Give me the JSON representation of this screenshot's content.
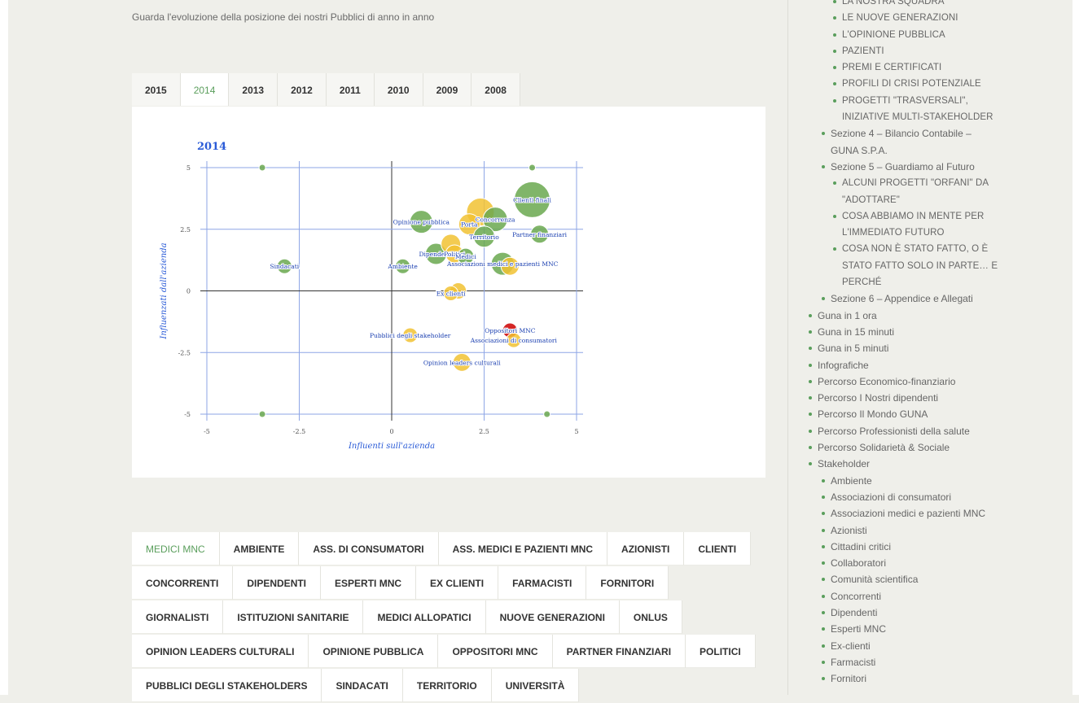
{
  "intro_text": "Guarda l'evoluzione della posizione dei nostri Pubblici di anno in anno",
  "year_tabs": [
    "2015",
    "2014",
    "2013",
    "2012",
    "2011",
    "2010",
    "2009",
    "2008"
  ],
  "active_year": "2014",
  "categories": [
    [
      "MEDICI MNC",
      "AMBIENTE",
      "ASS. DI CONSUMATORI",
      "ASS. MEDICI E PAZIENTI MNC",
      "AZIONISTI",
      "CLIENTI"
    ],
    [
      "CONCORRENTI",
      "DIPENDENTI",
      "ESPERTI MNC",
      "EX CLIENTI",
      "FARMACISTI",
      "FORNITORI"
    ],
    [
      "GIORNALISTI",
      "ISTITUZIONI SANITARIE",
      "MEDICI ALLOPATICI",
      "NUOVE GENERAZIONI",
      "ONLUS"
    ],
    [
      "OPINION LEADERS CULTURALI",
      "OPINIONE PUBBLICA",
      "OPPOSITORI MNC",
      "PARTNER FINANZIARI",
      "POLITICI"
    ],
    [
      "PUBBLICI DEGLI STAKEHOLDERS",
      "SINDACATI",
      "TERRITORIO",
      "UNIVERSITÀ"
    ]
  ],
  "active_category": "MEDICI MNC",
  "sidebar": [
    {
      "label": "LA NOSTRA SQUADRA",
      "level": 3
    },
    {
      "label": "LE NUOVE GENERAZIONI",
      "level": 3
    },
    {
      "label": "L'OPINIONE PUBBLICA",
      "level": 3
    },
    {
      "label": "PAZIENTI",
      "level": 3
    },
    {
      "label": "PREMI E CERTIFICATI",
      "level": 3
    },
    {
      "label": "PROFILI DI CRISI POTENZIALE",
      "level": 3
    },
    {
      "label": "PROGETTI \"TRASVERSALI\", INIZIATIVE MULTI-STAKEHOLDER",
      "level": 3
    },
    {
      "label": "Sezione 4 – Bilancio Contabile – GUNA S.P.A.",
      "level": 2
    },
    {
      "label": "Sezione 5 – Guardiamo al Futuro",
      "level": 2
    },
    {
      "label": "ALCUNI PROGETTI \"ORFANI\" DA \"ADOTTARE\"",
      "level": 3
    },
    {
      "label": "COSA ABBIAMO IN MENTE PER L'IMMEDIATO FUTURO",
      "level": 3
    },
    {
      "label": "COSA NON È STATO FATTO, O È STATO FATTO SOLO IN PARTE… E PERCHÉ",
      "level": 3
    },
    {
      "label": "Sezione 6 – Appendice e Allegati",
      "level": 2
    },
    {
      "label": "Guna in 1 ora",
      "level": 1
    },
    {
      "label": "Guna in 15 minuti",
      "level": 1
    },
    {
      "label": "Guna in 5 minuti",
      "level": 1
    },
    {
      "label": "Infografiche",
      "level": 1
    },
    {
      "label": "Percorso Economico-finanziario",
      "level": 1
    },
    {
      "label": "Percorso I Nostri dipendenti",
      "level": 1
    },
    {
      "label": "Percorso Il Mondo GUNA",
      "level": 1
    },
    {
      "label": "Percorso Professionisti della salute",
      "level": 1
    },
    {
      "label": "Percorso Solidarietà & Sociale",
      "level": 1
    },
    {
      "label": "Stakeholder",
      "level": 1
    },
    {
      "label": "Ambiente",
      "level": 2
    },
    {
      "label": "Associazioni di consumatori",
      "level": 2
    },
    {
      "label": "Associazioni medici e pazienti MNC",
      "level": 2
    },
    {
      "label": "Azionisti",
      "level": 2
    },
    {
      "label": "Cittadini critici",
      "level": 2
    },
    {
      "label": "Collaboratori",
      "level": 2
    },
    {
      "label": "Comunità scientifica",
      "level": 2
    },
    {
      "label": "Concorrenti",
      "level": 2
    },
    {
      "label": "Dipendenti",
      "level": 2
    },
    {
      "label": "Esperti MNC",
      "level": 2
    },
    {
      "label": "Ex-clienti",
      "level": 2
    },
    {
      "label": "Farmacisti",
      "level": 2
    },
    {
      "label": "Fornitori",
      "level": 2
    }
  ],
  "colors": {
    "accent": "#5a9e5c",
    "bubble_green": "#6aa84f",
    "bubble_yellow": "#f1c232",
    "bubble_red": "#cc0000",
    "axis_blue": "#2a5bd7"
  },
  "chart_data": {
    "type": "scatter",
    "title": "2014",
    "xlabel": "Influenti sull'azienda",
    "ylabel": "Influenzati dall'azienda",
    "xlim": [
      -5,
      5
    ],
    "ylim": [
      -5,
      5
    ],
    "xticks": [
      "-5",
      "-2.5",
      "0",
      "2.5",
      "5"
    ],
    "yticks": [
      "5",
      "2.5",
      "0",
      "-2.5",
      "-5"
    ],
    "grid": true,
    "points": [
      {
        "label": "Clienti finali",
        "x": 3.8,
        "y": 3.7,
        "r": 2.2,
        "color": "green"
      },
      {
        "label": "",
        "x": 2.4,
        "y": 3.2,
        "r": 1.7,
        "color": "yellow"
      },
      {
        "label": "Concorrenza",
        "x": 2.8,
        "y": 2.9,
        "r": 1.5,
        "color": "green"
      },
      {
        "label": "Partner finanziari",
        "x": 4.0,
        "y": 2.3,
        "r": 1.1,
        "color": "green"
      },
      {
        "label": "Opinione pubblica",
        "x": 0.8,
        "y": 2.8,
        "r": 1.4,
        "color": "green"
      },
      {
        "label": "Porta",
        "x": 2.1,
        "y": 2.7,
        "r": 1.3,
        "color": "yellow"
      },
      {
        "label": "Territorio",
        "x": 2.5,
        "y": 2.2,
        "r": 1.3,
        "color": "green"
      },
      {
        "label": "",
        "x": 1.6,
        "y": 1.9,
        "r": 1.2,
        "color": "yellow"
      },
      {
        "label": "Politici",
        "x": 1.7,
        "y": 1.5,
        "r": 1.1,
        "color": "yellow"
      },
      {
        "label": "Dipendenti",
        "x": 1.2,
        "y": 1.5,
        "r": 1.3,
        "color": "green"
      },
      {
        "label": "Medici",
        "x": 2.0,
        "y": 1.4,
        "r": 1.0,
        "color": "green"
      },
      {
        "label": "Associazioni medici e pazienti MNC",
        "x": 3.0,
        "y": 1.1,
        "r": 1.4,
        "color": "green"
      },
      {
        "label": "",
        "x": 3.2,
        "y": 1.0,
        "r": 1.1,
        "color": "yellow"
      },
      {
        "label": "Sindacati",
        "x": -2.9,
        "y": 1.0,
        "r": 0.9,
        "color": "green"
      },
      {
        "label": "Ambiente",
        "x": 0.3,
        "y": 1.0,
        "r": 0.9,
        "color": "green"
      },
      {
        "label": "Ex clienti",
        "x": 1.6,
        "y": -0.1,
        "r": 0.9,
        "color": "yellow"
      },
      {
        "label": "",
        "x": 1.8,
        "y": 0.0,
        "r": 1.0,
        "color": "yellow"
      },
      {
        "label": "Oppositori MNC",
        "x": 3.2,
        "y": -1.6,
        "r": 0.9,
        "color": "red"
      },
      {
        "label": "Associazioni di consumatori",
        "x": 3.3,
        "y": -2.0,
        "r": 0.9,
        "color": "yellow"
      },
      {
        "label": "Pubblici degli stakeholder",
        "x": 0.5,
        "y": -1.8,
        "r": 0.9,
        "color": "yellow"
      },
      {
        "label": "Opinion leaders culturali",
        "x": 1.9,
        "y": -2.9,
        "r": 1.1,
        "color": "yellow"
      },
      {
        "label": "",
        "x": -3.5,
        "y": 5.0,
        "r": 0.4,
        "color": "green"
      },
      {
        "label": "",
        "x": 3.8,
        "y": 5.0,
        "r": 0.4,
        "color": "green"
      },
      {
        "label": "",
        "x": -3.5,
        "y": -5.0,
        "r": 0.4,
        "color": "green"
      },
      {
        "label": "",
        "x": 4.2,
        "y": -5.0,
        "r": 0.4,
        "color": "green"
      }
    ]
  }
}
